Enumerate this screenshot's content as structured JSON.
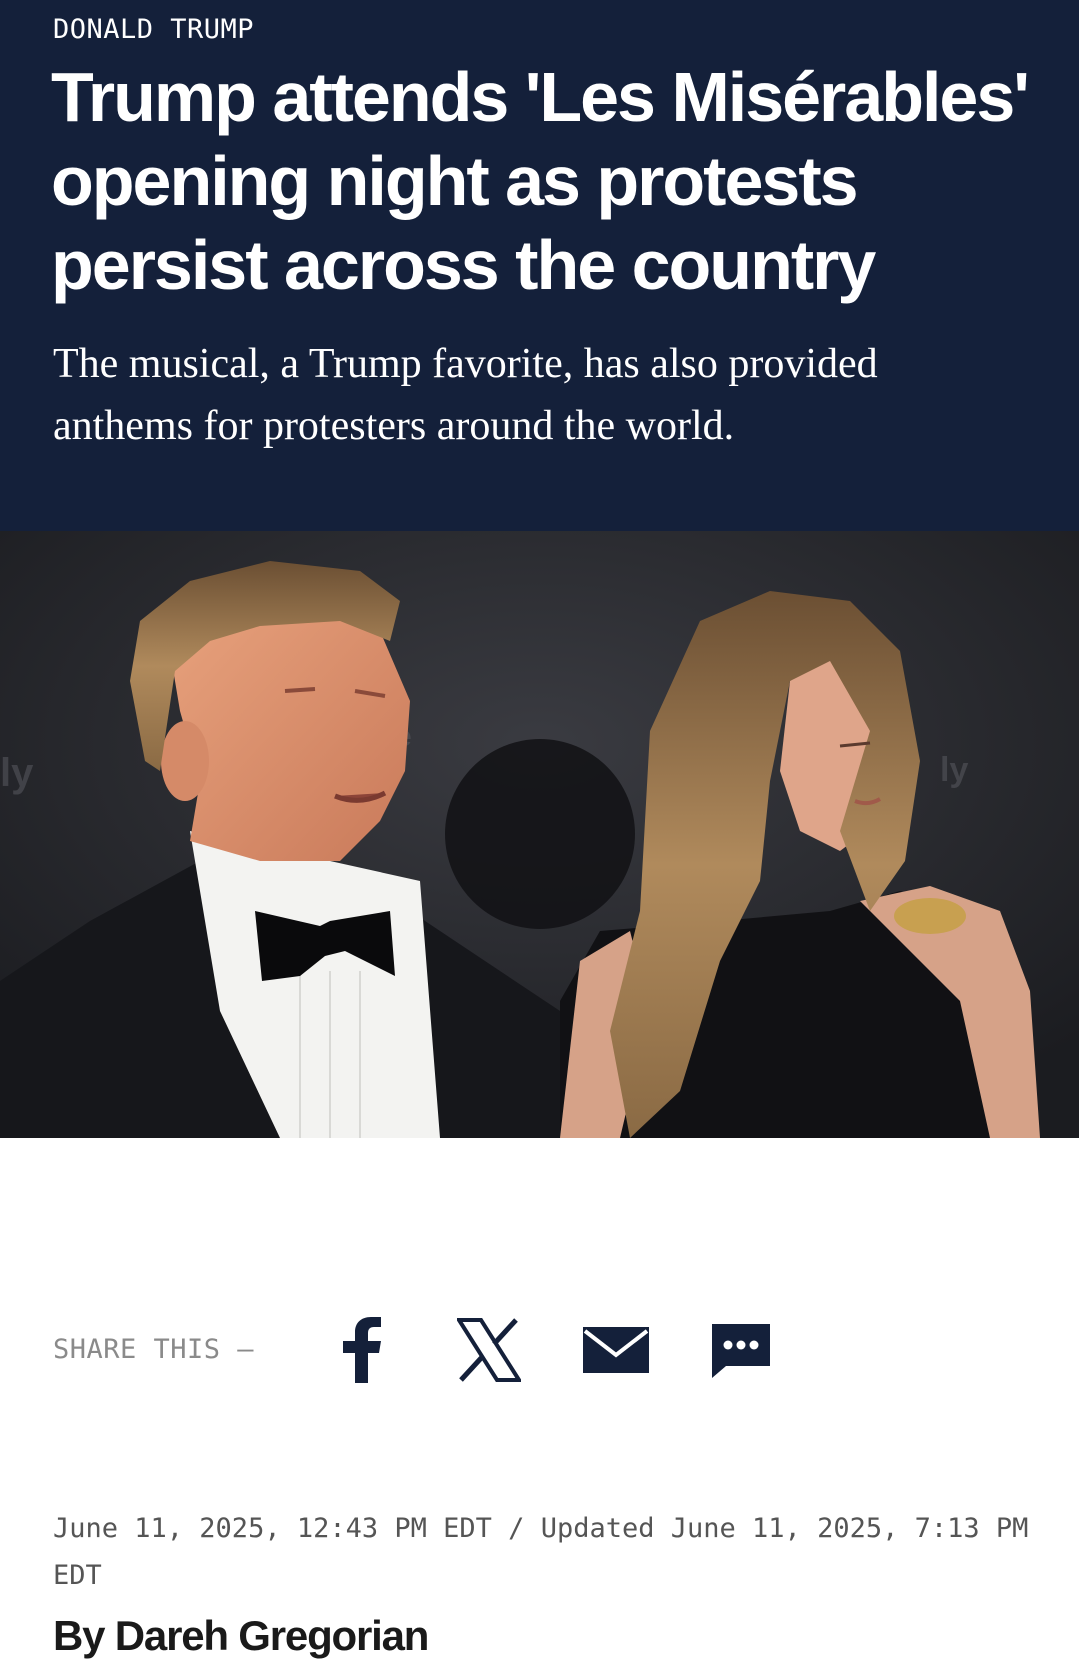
{
  "article": {
    "section": "DONALD TRUMP",
    "headline": "Trump attends 'Les Misérables' opening night as protests persist across the country",
    "dek": "The musical, a Trump favorite, has also provided anthems for protesters around the world.",
    "byline_prefix": "By",
    "author": "Dareh Gregorian"
  },
  "media": {
    "type": "video",
    "play_icon": "play-icon"
  },
  "share": {
    "label": "SHARE THIS —",
    "buttons": [
      {
        "name": "facebook",
        "icon": "facebook-icon"
      },
      {
        "name": "x",
        "icon": "x-icon"
      },
      {
        "name": "email",
        "icon": "mail-icon"
      },
      {
        "name": "sms",
        "icon": "message-icon"
      }
    ]
  },
  "dates": {
    "published": "June 11, 2025, 12:43 PM EDT",
    "separator": "/",
    "updated_label": "Updated",
    "updated": "June 11, 2025, 7:13 PM EDT"
  },
  "colors": {
    "header_bg": "#14203a",
    "icon_color": "#14203a",
    "meta_text": "#555555",
    "share_label": "#8a8a8a"
  }
}
